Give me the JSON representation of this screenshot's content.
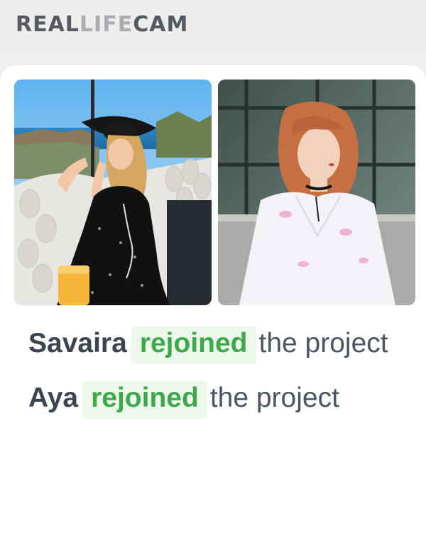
{
  "header": {
    "logo_part1": "REAL",
    "logo_part2": "LIFE",
    "logo_part3": "CAM"
  },
  "photos": [
    {
      "icon": "photo-woman-hat-sea",
      "accent": "#2a8ee0"
    },
    {
      "icon": "photo-woman-white-shirt",
      "accent": "#d35a4a"
    }
  ],
  "feed": [
    {
      "name": "Savaira",
      "action": "rejoined",
      "suffix": "the project"
    },
    {
      "name": "Aya",
      "action": "rejoined",
      "suffix": "the project"
    }
  ],
  "colors": {
    "accent_green": "#3ca94a",
    "tag_bg": "#eef7ec",
    "text": "#4b5563"
  }
}
